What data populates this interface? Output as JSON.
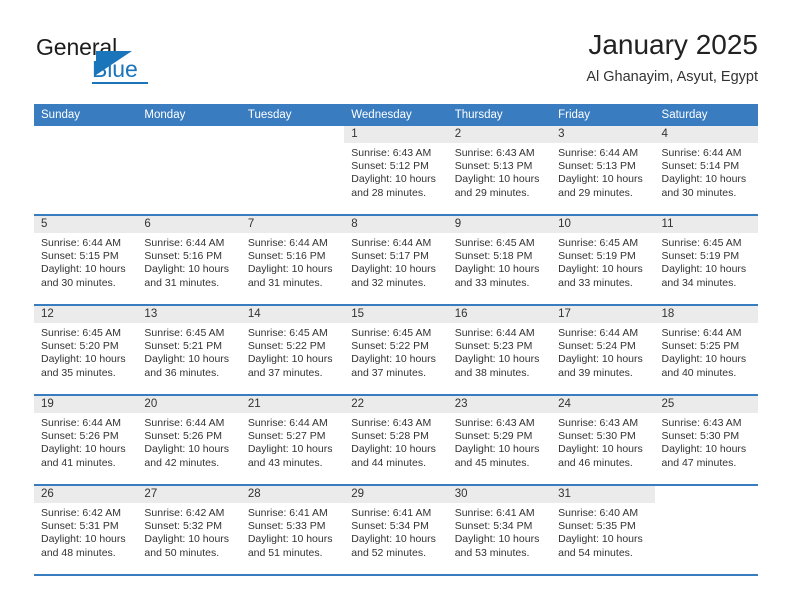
{
  "brand": {
    "name_part1": "General",
    "name_part2": "Blue",
    "triangle_icon": "triangle-icon",
    "accent_color": "#1b75bb"
  },
  "header": {
    "title": "January 2025",
    "location": "Al Ghanayim, Asyut, Egypt"
  },
  "theme": {
    "header_blue": "#3a7cc0",
    "daynum_band": "#ebebeb",
    "text": "#333333"
  },
  "weekdays": [
    "Sunday",
    "Monday",
    "Tuesday",
    "Wednesday",
    "Thursday",
    "Friday",
    "Saturday"
  ],
  "weeks": [
    [
      {
        "day": "",
        "sunrise": "",
        "sunset": "",
        "daylight": "",
        "empty": true
      },
      {
        "day": "",
        "sunrise": "",
        "sunset": "",
        "daylight": "",
        "empty": true
      },
      {
        "day": "",
        "sunrise": "",
        "sunset": "",
        "daylight": "",
        "empty": true
      },
      {
        "day": "1",
        "sunrise": "Sunrise: 6:43 AM",
        "sunset": "Sunset: 5:12 PM",
        "daylight": "Daylight: 10 hours and 28 minutes."
      },
      {
        "day": "2",
        "sunrise": "Sunrise: 6:43 AM",
        "sunset": "Sunset: 5:13 PM",
        "daylight": "Daylight: 10 hours and 29 minutes."
      },
      {
        "day": "3",
        "sunrise": "Sunrise: 6:44 AM",
        "sunset": "Sunset: 5:13 PM",
        "daylight": "Daylight: 10 hours and 29 minutes."
      },
      {
        "day": "4",
        "sunrise": "Sunrise: 6:44 AM",
        "sunset": "Sunset: 5:14 PM",
        "daylight": "Daylight: 10 hours and 30 minutes."
      }
    ],
    [
      {
        "day": "5",
        "sunrise": "Sunrise: 6:44 AM",
        "sunset": "Sunset: 5:15 PM",
        "daylight": "Daylight: 10 hours and 30 minutes."
      },
      {
        "day": "6",
        "sunrise": "Sunrise: 6:44 AM",
        "sunset": "Sunset: 5:16 PM",
        "daylight": "Daylight: 10 hours and 31 minutes."
      },
      {
        "day": "7",
        "sunrise": "Sunrise: 6:44 AM",
        "sunset": "Sunset: 5:16 PM",
        "daylight": "Daylight: 10 hours and 31 minutes."
      },
      {
        "day": "8",
        "sunrise": "Sunrise: 6:44 AM",
        "sunset": "Sunset: 5:17 PM",
        "daylight": "Daylight: 10 hours and 32 minutes."
      },
      {
        "day": "9",
        "sunrise": "Sunrise: 6:45 AM",
        "sunset": "Sunset: 5:18 PM",
        "daylight": "Daylight: 10 hours and 33 minutes."
      },
      {
        "day": "10",
        "sunrise": "Sunrise: 6:45 AM",
        "sunset": "Sunset: 5:19 PM",
        "daylight": "Daylight: 10 hours and 33 minutes."
      },
      {
        "day": "11",
        "sunrise": "Sunrise: 6:45 AM",
        "sunset": "Sunset: 5:19 PM",
        "daylight": "Daylight: 10 hours and 34 minutes."
      }
    ],
    [
      {
        "day": "12",
        "sunrise": "Sunrise: 6:45 AM",
        "sunset": "Sunset: 5:20 PM",
        "daylight": "Daylight: 10 hours and 35 minutes."
      },
      {
        "day": "13",
        "sunrise": "Sunrise: 6:45 AM",
        "sunset": "Sunset: 5:21 PM",
        "daylight": "Daylight: 10 hours and 36 minutes."
      },
      {
        "day": "14",
        "sunrise": "Sunrise: 6:45 AM",
        "sunset": "Sunset: 5:22 PM",
        "daylight": "Daylight: 10 hours and 37 minutes."
      },
      {
        "day": "15",
        "sunrise": "Sunrise: 6:45 AM",
        "sunset": "Sunset: 5:22 PM",
        "daylight": "Daylight: 10 hours and 37 minutes."
      },
      {
        "day": "16",
        "sunrise": "Sunrise: 6:44 AM",
        "sunset": "Sunset: 5:23 PM",
        "daylight": "Daylight: 10 hours and 38 minutes."
      },
      {
        "day": "17",
        "sunrise": "Sunrise: 6:44 AM",
        "sunset": "Sunset: 5:24 PM",
        "daylight": "Daylight: 10 hours and 39 minutes."
      },
      {
        "day": "18",
        "sunrise": "Sunrise: 6:44 AM",
        "sunset": "Sunset: 5:25 PM",
        "daylight": "Daylight: 10 hours and 40 minutes."
      }
    ],
    [
      {
        "day": "19",
        "sunrise": "Sunrise: 6:44 AM",
        "sunset": "Sunset: 5:26 PM",
        "daylight": "Daylight: 10 hours and 41 minutes."
      },
      {
        "day": "20",
        "sunrise": "Sunrise: 6:44 AM",
        "sunset": "Sunset: 5:26 PM",
        "daylight": "Daylight: 10 hours and 42 minutes."
      },
      {
        "day": "21",
        "sunrise": "Sunrise: 6:44 AM",
        "sunset": "Sunset: 5:27 PM",
        "daylight": "Daylight: 10 hours and 43 minutes."
      },
      {
        "day": "22",
        "sunrise": "Sunrise: 6:43 AM",
        "sunset": "Sunset: 5:28 PM",
        "daylight": "Daylight: 10 hours and 44 minutes."
      },
      {
        "day": "23",
        "sunrise": "Sunrise: 6:43 AM",
        "sunset": "Sunset: 5:29 PM",
        "daylight": "Daylight: 10 hours and 45 minutes."
      },
      {
        "day": "24",
        "sunrise": "Sunrise: 6:43 AM",
        "sunset": "Sunset: 5:30 PM",
        "daylight": "Daylight: 10 hours and 46 minutes."
      },
      {
        "day": "25",
        "sunrise": "Sunrise: 6:43 AM",
        "sunset": "Sunset: 5:30 PM",
        "daylight": "Daylight: 10 hours and 47 minutes."
      }
    ],
    [
      {
        "day": "26",
        "sunrise": "Sunrise: 6:42 AM",
        "sunset": "Sunset: 5:31 PM",
        "daylight": "Daylight: 10 hours and 48 minutes."
      },
      {
        "day": "27",
        "sunrise": "Sunrise: 6:42 AM",
        "sunset": "Sunset: 5:32 PM",
        "daylight": "Daylight: 10 hours and 50 minutes."
      },
      {
        "day": "28",
        "sunrise": "Sunrise: 6:41 AM",
        "sunset": "Sunset: 5:33 PM",
        "daylight": "Daylight: 10 hours and 51 minutes."
      },
      {
        "day": "29",
        "sunrise": "Sunrise: 6:41 AM",
        "sunset": "Sunset: 5:34 PM",
        "daylight": "Daylight: 10 hours and 52 minutes."
      },
      {
        "day": "30",
        "sunrise": "Sunrise: 6:41 AM",
        "sunset": "Sunset: 5:34 PM",
        "daylight": "Daylight: 10 hours and 53 minutes."
      },
      {
        "day": "31",
        "sunrise": "Sunrise: 6:40 AM",
        "sunset": "Sunset: 5:35 PM",
        "daylight": "Daylight: 10 hours and 54 minutes."
      },
      {
        "day": "",
        "sunrise": "",
        "sunset": "",
        "daylight": "",
        "empty": true
      }
    ]
  ]
}
